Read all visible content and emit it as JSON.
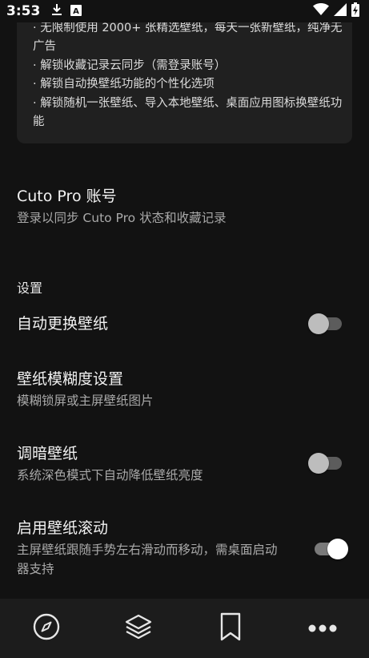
{
  "status_bar": {
    "time": "3:53",
    "icons": [
      "download-icon",
      "keyboard-a-icon",
      "wifi-icon",
      "cellular-signal-icon",
      "battery-charging-icon"
    ]
  },
  "premium_card": {
    "lines": [
      "· 无限制使用 2000+ 张精选壁纸，每天一张新壁纸，纯净无广告",
      "· 解锁收藏记录云同步（需登录账号）",
      "· 解锁自动换壁纸功能的个性化选项",
      "· 解锁随机一张壁纸、导入本地壁纸、桌面应用图标换壁纸功能"
    ]
  },
  "account": {
    "title": "Cuto Pro 账号",
    "subtitle": "登录以同步 Cuto Pro 状态和收藏记录"
  },
  "settings": {
    "header": "设置",
    "auto_change": {
      "title": "自动更换壁纸",
      "enabled": false
    },
    "blur": {
      "title": "壁纸模糊度设置",
      "subtitle": "模糊锁屏或主屏壁纸图片"
    },
    "dim": {
      "title": "调暗壁纸",
      "subtitle": "系统深色模式下自动降低壁纸亮度",
      "enabled": false
    },
    "scroll": {
      "title": "启用壁纸滚动",
      "subtitle": "主屏壁纸跟随手势左右滑动而移动，需桌面启动器支持",
      "enabled": true
    }
  },
  "bottom_nav": {
    "items": [
      "compass-icon",
      "layers-icon",
      "bookmark-icon",
      "more-horizontal-icon"
    ]
  },
  "colors": {
    "background": "#121212",
    "card": "#202020",
    "nav": "#1c1c1c",
    "text_primary": "#f2f2f2",
    "text_secondary": "#a9a9a9"
  }
}
